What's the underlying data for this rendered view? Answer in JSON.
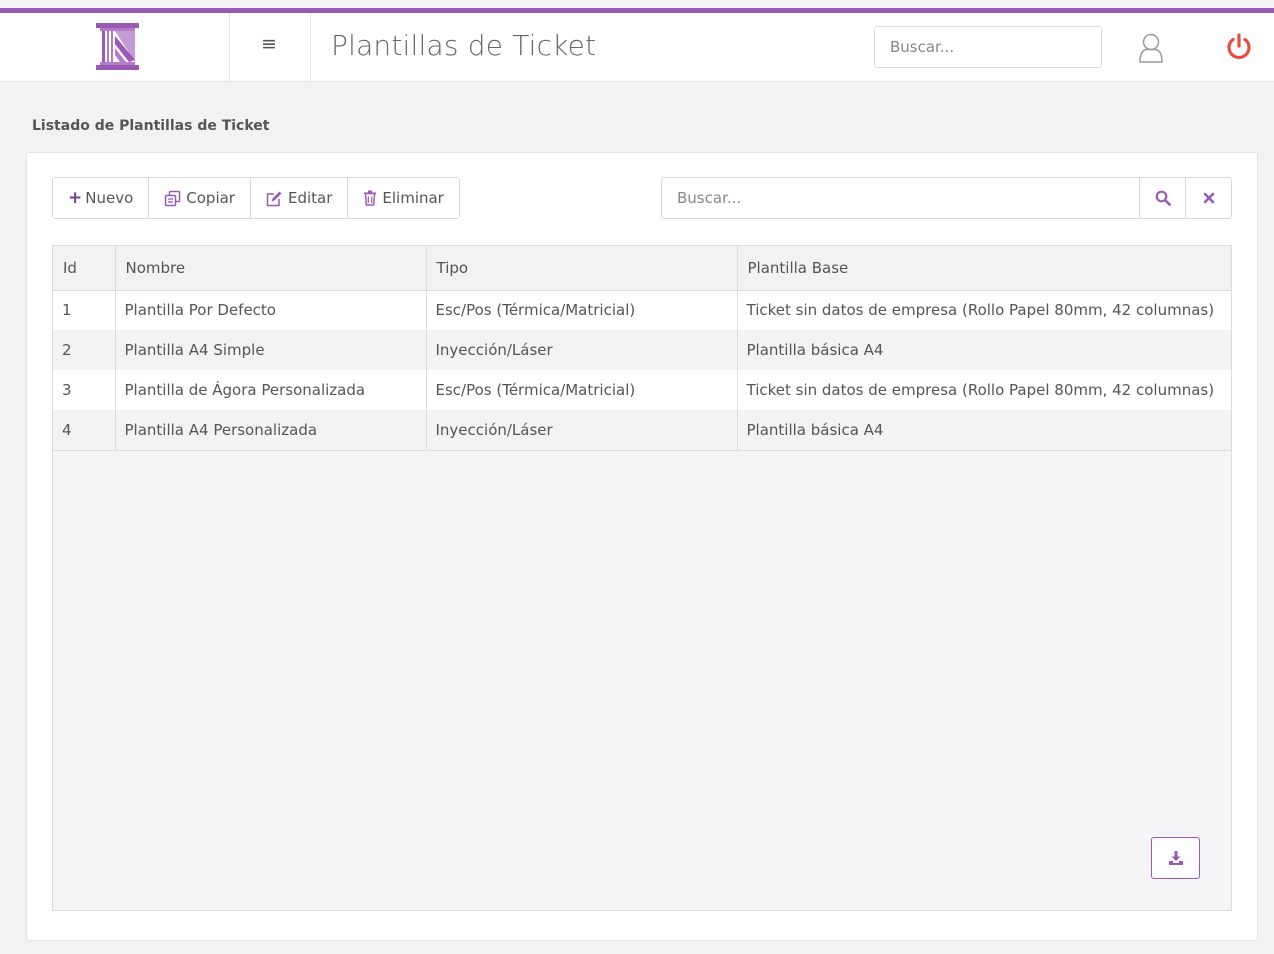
{
  "header": {
    "title": "Plantillas de Ticket",
    "search_placeholder": "Buscar...",
    "menu_icon": "hamburger-icon",
    "user_icon": "user-icon",
    "power_icon": "power-icon"
  },
  "section": {
    "heading": "Listado de Plantillas de Ticket"
  },
  "toolbar": {
    "new_label": "Nuevo",
    "copy_label": "Copiar",
    "edit_label": "Editar",
    "delete_label": "Eliminar",
    "search_placeholder": "Buscar..."
  },
  "table": {
    "columns": [
      "Id",
      "Nombre",
      "Tipo",
      "Plantilla Base"
    ],
    "rows": [
      [
        "1",
        "Plantilla Por Defecto",
        "Esc/Pos (Térmica/Matricial)",
        "Ticket sin datos de empresa (Rollo Papel 80mm, 42 columnas)"
      ],
      [
        "2",
        "Plantilla A4 Simple",
        "Inyección/Láser",
        "Plantilla básica A4"
      ],
      [
        "3",
        "Plantilla de Ágora Personalizada",
        "Esc/Pos (Térmica/Matricial)",
        "Ticket sin datos de empresa (Rollo Papel 80mm, 42 columnas)"
      ],
      [
        "4",
        "Plantilla A4 Personalizada",
        "Inyección/Láser",
        "Plantilla básica A4"
      ]
    ]
  },
  "colors": {
    "accent": "#9b59b6",
    "power": "#e74c3c"
  }
}
